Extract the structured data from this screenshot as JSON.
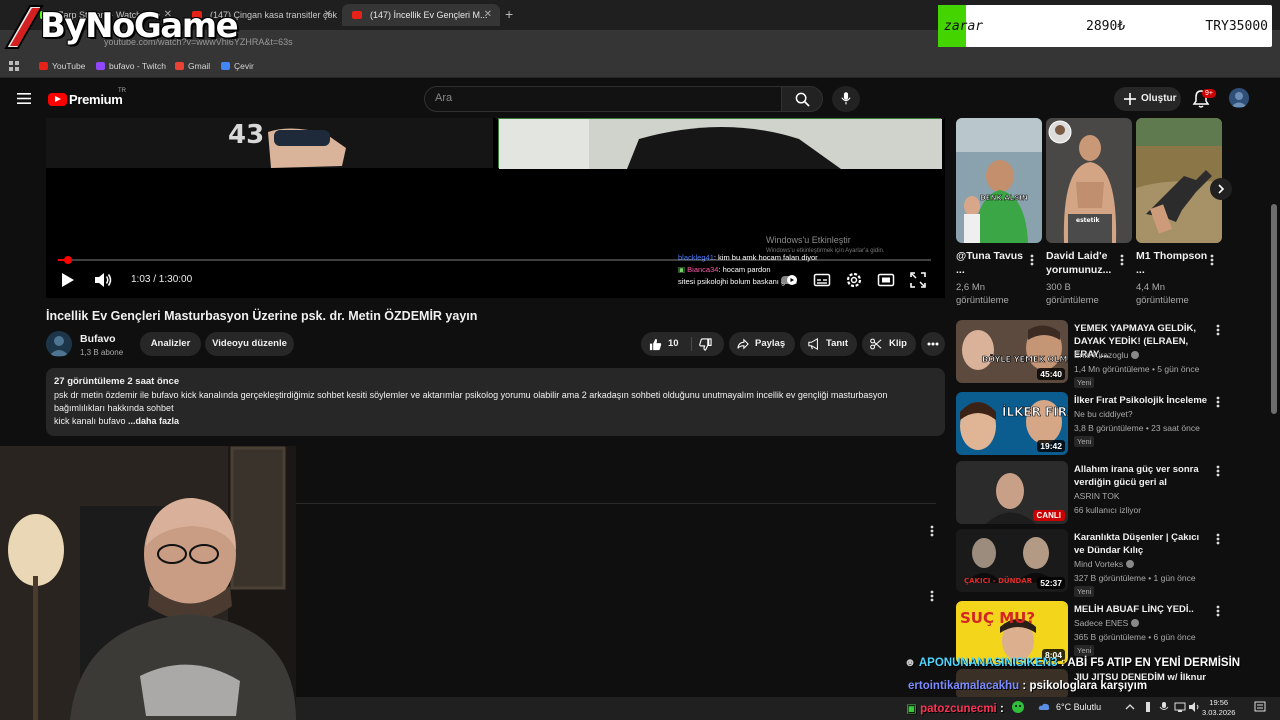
{
  "overlay": {
    "logo_text": "ByNoGame",
    "ticker": {
      "label": "zarar",
      "price": "2890₺",
      "target": "TRY35000"
    }
  },
  "browser": {
    "tabs": [
      {
        "label": "Zarp Stream - Watch Live"
      },
      {
        "label": "(147) Çingan kasa transitler çok"
      },
      {
        "label": "(147) İncellik Ev Gençleri M..."
      }
    ],
    "url": "youtube.com/watch?v=wwwVhl6YZHRA&t=63s",
    "bookmarks": [
      "YouTube",
      "bufavo - Twitch",
      "Gmail",
      "Çevir"
    ]
  },
  "header": {
    "brand": "Premium",
    "region": "TR",
    "search_placeholder": "Ara",
    "create_label": "Oluştur",
    "notif_count": "9+"
  },
  "player": {
    "time": "1:03 / 1:30:00",
    "progress_fraction": 0.012,
    "chat_lines": [
      {
        "user": "blackleg41",
        "text": ": kim bu amk hocam falan diyor"
      },
      {
        "user": "Bianca34",
        "text": ": hocam pardon"
      },
      {
        "user": "",
        "text": "sitesi psikolojhi bolum baskanı geldi"
      }
    ],
    "activate": "Windows'u Etkinleştir",
    "activate_sub": "Windows'u etkinleştirmek için Ayarlar'a gidin."
  },
  "video": {
    "title": "İncellik Ev Gençleri Masturbasyon Üzerine psk. dr. Metin ÖZDEMİR yayın",
    "channel": "Bufavo",
    "subs": "1,3 B abone",
    "analytics_label": "Analizler",
    "edit_label": "Videoyu düzenle",
    "likes": "10",
    "share_label": "Paylaş",
    "promote_label": "Tanıt",
    "clip_label": "Klip"
  },
  "description": {
    "meta": "27 görüntüleme  2 saat önce",
    "body": "psk dr metin özdemir ile bufavo kick kanalında gerçekleştirdiğimiz sohbet kesiti söylemler ve aktarımlar psikolog yorumu olabilir ama 2 arkadaşın sohbeti olduğunu unutmayalım incellik ev gençliği masturbasyon bağımlılıkları hakkında sohbet",
    "last_line": "kick kanalı bufavo",
    "more": " ...daha fazla"
  },
  "shorts": [
    {
      "title": "@Tuna Tavus ...",
      "views": "2,6 Mn görüntüleme",
      "thumb_text": "DENK ALSIN"
    },
    {
      "title": "David Laid'e yorumunuz...",
      "views": "300 B görüntüleme",
      "thumb_text": "estetik"
    },
    {
      "title": "M1 Thompson ...",
      "views": "4,4 Mn görüntüleme",
      "thumb_text": ""
    }
  ],
  "recommendations": [
    {
      "title": "YEMEK YAPMAYA GELDİK, DAYAK YEDİK! (ELRAEN, ERAY,...",
      "channel": "Enis Kirazoglu",
      "meta": "1,4 Mn görüntüleme • 5 gün önce",
      "badge": "Yeni",
      "duration": "45:40",
      "thumb_text": "BÖYLE YEMEK OLMAZ!"
    },
    {
      "title": "İlker Fırat Psikolojik İnceleme",
      "channel": "Ne bu ciddiyet?",
      "meta": "3,8 B görüntüleme • 23 saat önce",
      "badge": "Yeni",
      "duration": "19:42",
      "thumb_text": "İLKER FIRAT"
    },
    {
      "title": "Allahım irana güç ver sonra verdiğin gücü geri al",
      "channel": "ASRIN TOK",
      "meta": "66 kullanıcı izliyor",
      "badge": "",
      "live": "CANLI",
      "thumb_text": ""
    },
    {
      "title": "Karanlıkta Düşenler | Çakıcı ve Dündar Kılıç",
      "channel": "Mind Vorteks",
      "meta": "327 B görüntüleme • 1 gün önce",
      "badge": "Yeni",
      "duration": "52:37",
      "thumb_text": "ÇAKICI - DÜNDAR"
    },
    {
      "title": "MELİH ABUAF LİNÇ YEDİ..",
      "channel": "Sadece ENES",
      "meta": "365 B görüntüleme • 6 gün önce",
      "badge": "Yeni",
      "duration": "8:04",
      "thumb_text": "SUÇ MU?"
    },
    {
      "title": "JIU JITSU DENEDİM w/ İlknur",
      "channel": "",
      "meta": "",
      "badge": "",
      "thumb_text": ""
    }
  ],
  "stream_chat": [
    {
      "user": "APONUNANASINISIKEN3",
      "sep": " : ",
      "text": "ABİ F5 ATIP EN YENİ DERMİSİN",
      "user_color": "#4fd6ff"
    },
    {
      "user": "ertointikamalacakhu",
      "sep": " : ",
      "text": "psikologlara karşıyım",
      "user_color": "#7a8cff"
    },
    {
      "user": "patozcunecmi",
      "sep": " : ",
      "text": "",
      "user_color": "#ff3355"
    }
  ],
  "taskbar": {
    "weather": "6°C  Bulutlu",
    "time": "19:56",
    "date": "3.03.2026"
  }
}
